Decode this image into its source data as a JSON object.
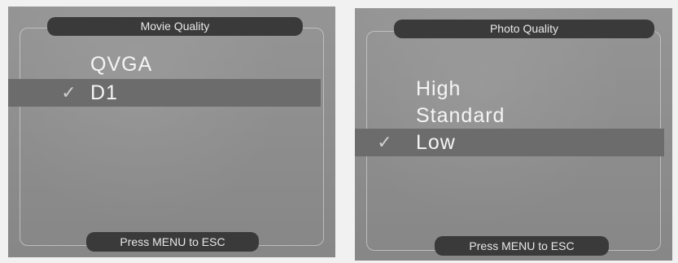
{
  "movie_quality": {
    "title": "Movie Quality",
    "options": [
      {
        "label": "QVGA",
        "selected": false,
        "check": ""
      },
      {
        "label": "D1",
        "selected": true,
        "check": "✓"
      }
    ],
    "footer": "Press MENU to ESC"
  },
  "photo_quality": {
    "title": "Photo Quality",
    "options": [
      {
        "label": "High",
        "selected": false,
        "check": ""
      },
      {
        "label": "Standard",
        "selected": false,
        "check": ""
      },
      {
        "label": "Low",
        "selected": true,
        "check": "✓"
      }
    ],
    "footer": "Press MENU to ESC"
  },
  "icons": {
    "checkmark": "check-icon"
  }
}
